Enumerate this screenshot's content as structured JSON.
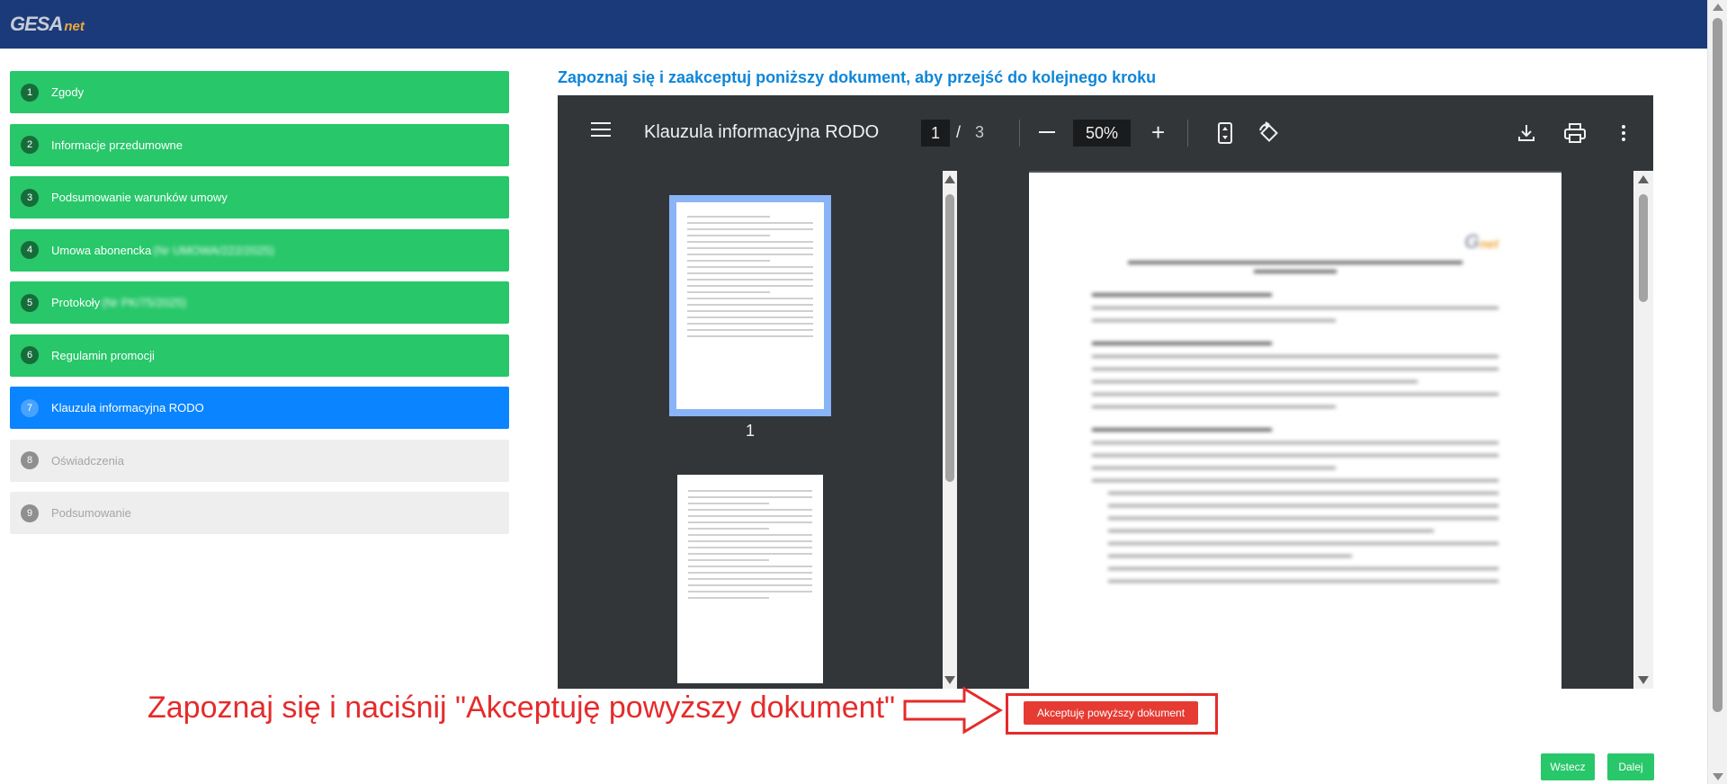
{
  "brand": {
    "logo_main": "GESA",
    "logo_suffix": "net"
  },
  "steps": [
    {
      "num": "1",
      "label": "Zgody",
      "extra": "",
      "state": "done"
    },
    {
      "num": "2",
      "label": "Informacje przedumowne",
      "extra": "",
      "state": "done"
    },
    {
      "num": "3",
      "label": "Podsumowanie warunków umowy",
      "extra": "",
      "state": "done"
    },
    {
      "num": "4",
      "label": "Umowa abonencka",
      "extra": "(Nr UMOWA/222/2025)",
      "state": "done"
    },
    {
      "num": "5",
      "label": "Protokoły",
      "extra": "(Nr PK/75/2025)",
      "state": "done"
    },
    {
      "num": "6",
      "label": "Regulamin promocji",
      "extra": "",
      "state": "done"
    },
    {
      "num": "7",
      "label": "Klauzula informacyjna RODO",
      "extra": "",
      "state": "active"
    },
    {
      "num": "8",
      "label": "Oświadczenia",
      "extra": "",
      "state": "todo"
    },
    {
      "num": "9",
      "label": "Podsumowanie",
      "extra": "",
      "state": "todo"
    }
  ],
  "document": {
    "heading": "Zapoznaj się i zaakceptuj poniższy dokument, aby przejść do kolejnego kroku"
  },
  "viewer": {
    "title": "Klauzula informacyjna RODO",
    "current_page": "1",
    "page_separator": "/",
    "total_pages": "3",
    "zoom": "50%",
    "thumbnail_label": "1",
    "icons": [
      "menu-icon",
      "zoom-out-icon",
      "zoom-in-icon",
      "fit-page-icon",
      "rotate-icon",
      "download-icon",
      "print-icon",
      "more-vert-icon"
    ]
  },
  "annotation": {
    "text": "Zapoznaj się i naciśnij \"Akceptuję powyższy dokument\""
  },
  "actions": {
    "accept_label": "Akceptuję powyższy dokument",
    "back_label": "Wstecz",
    "next_label": "Dalej"
  },
  "colors": {
    "topbar": "#1b3a7a",
    "done": "#28c76a",
    "active": "#0a84ff",
    "todo": "#eeeeee",
    "accent_red": "#e52b2b",
    "heading_blue": "#0f86d8"
  }
}
